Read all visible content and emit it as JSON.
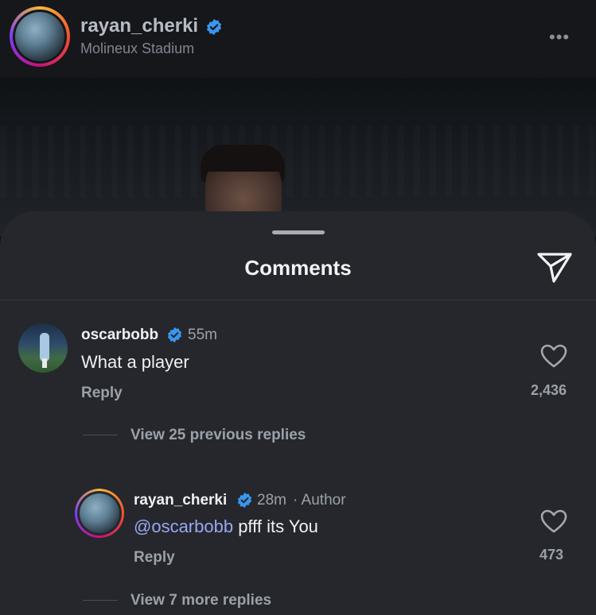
{
  "post": {
    "username": "rayan_cherki",
    "location": "Molineux Stadium",
    "more": "•••"
  },
  "sheet": {
    "title": "Comments"
  },
  "comments": [
    {
      "username": "oscarbobb",
      "time": "55m",
      "text": "What a player",
      "reply_label": "Reply",
      "likes": "2,436",
      "view_replies": "View 25 previous replies"
    }
  ],
  "reply": {
    "username": "rayan_cherki",
    "time": "28m",
    "author_label": "· Author",
    "mention": "@oscarbobb",
    "text": " pfff its You",
    "reply_label": "Reply",
    "likes": "473",
    "view_more": "View 7 more replies"
  },
  "colors": {
    "verified": "#3897f0",
    "mention": "#9aa7f2",
    "sheet_bg": "#25272c"
  }
}
